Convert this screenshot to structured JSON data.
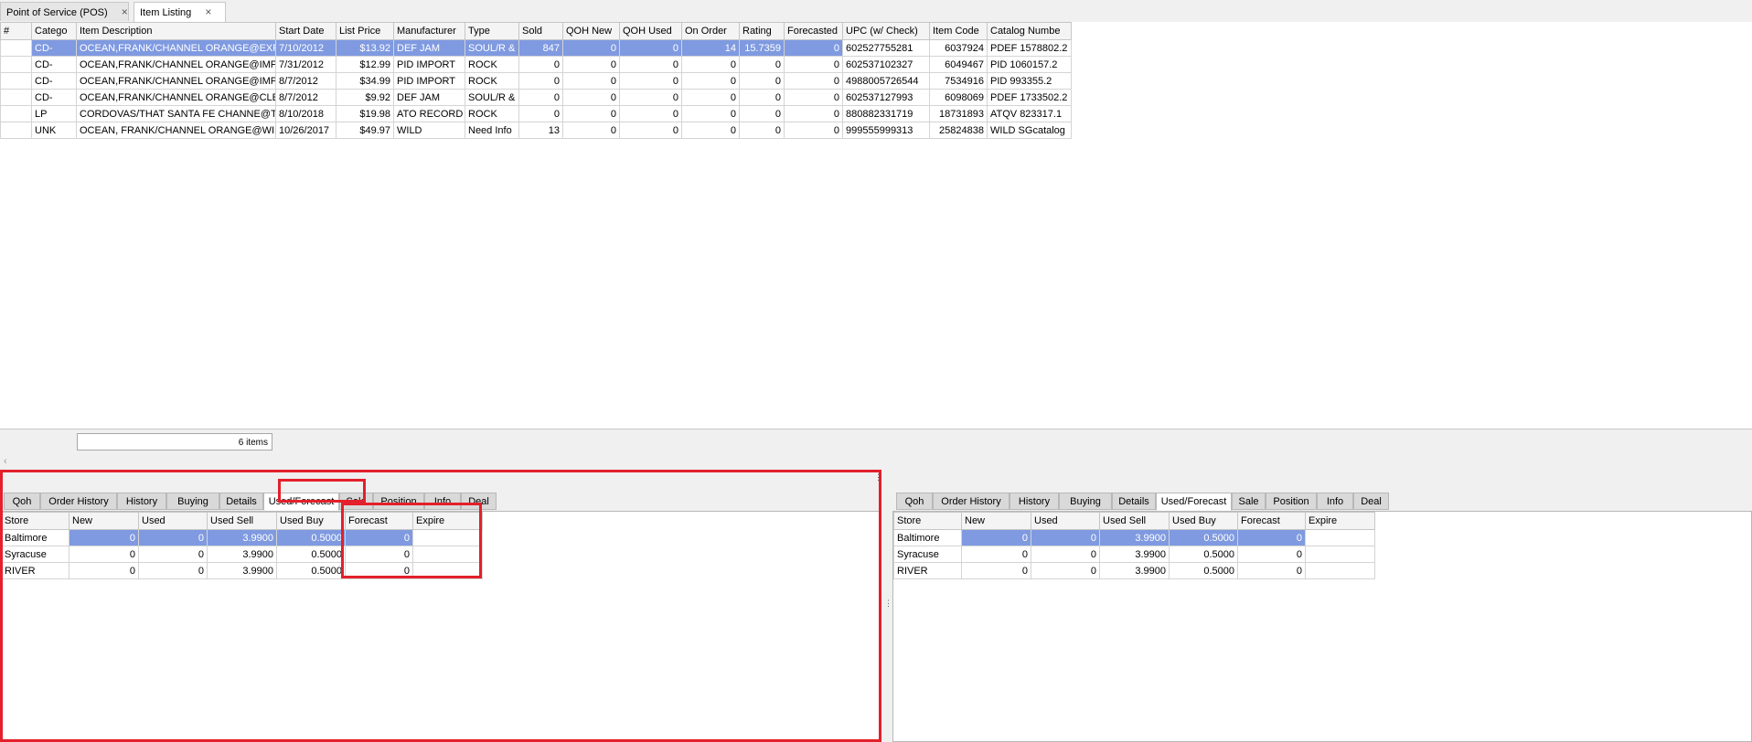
{
  "doc_tabs": [
    {
      "label": "Point of Service (POS)",
      "close": "×"
    },
    {
      "label": "Item Listing",
      "close": "×"
    }
  ],
  "listing": {
    "columns": [
      "#",
      "Catego",
      "Item Description",
      "Start Date",
      "List Price",
      "Manufacturer",
      "Type",
      "Sold",
      "QOH New",
      "QOH Used",
      "On Order",
      "Rating",
      "Forecasted",
      "UPC (w/ Check)",
      "Item Code",
      "Catalog Numbe"
    ],
    "rows": [
      [
        "",
        "CD-",
        "OCEAN,FRANK/CHANNEL ORANGE@EXPL",
        "7/10/2012",
        "$13.92",
        "DEF JAM",
        "SOUL/R &",
        "847",
        "0",
        "0",
        "14",
        "15.7359",
        "0",
        "602527755281",
        "6037924",
        "PDEF 1578802.2"
      ],
      [
        "",
        "CD-",
        "OCEAN,FRANK/CHANNEL ORANGE@IMP",
        "7/31/2012",
        "$12.99",
        "PID IMPORT",
        "ROCK",
        "0",
        "0",
        "0",
        "0",
        "0",
        "0",
        "602537102327",
        "6049467",
        "PID 1060157.2"
      ],
      [
        "",
        "CD-",
        "OCEAN,FRANK/CHANNEL ORANGE@IMP",
        "8/7/2012",
        "$34.99",
        "PID IMPORT",
        "ROCK",
        "0",
        "0",
        "0",
        "0",
        "0",
        "0",
        "4988005726544",
        "7534916",
        "PID 993355.2"
      ],
      [
        "",
        "CD-",
        "OCEAN,FRANK/CHANNEL ORANGE@CLEA",
        "8/7/2012",
        "$9.92",
        "DEF JAM",
        "SOUL/R &",
        "0",
        "0",
        "0",
        "0",
        "0",
        "0",
        "602537127993",
        "6098069",
        "PDEF 1733502.2"
      ],
      [
        "",
        "LP",
        "CORDOVAS/THAT SANTA FE CHANNE@T",
        "8/10/2018",
        "$19.98",
        "ATO RECORD",
        "ROCK",
        "0",
        "0",
        "0",
        "0",
        "0",
        "0",
        "880882331719",
        "18731893",
        "ATQV 823317.1"
      ],
      [
        "",
        "UNK",
        "OCEAN, FRANK/CHANNEL ORANGE@WIL",
        "10/26/2017",
        "$49.97",
        "WILD",
        "Need Info",
        "13",
        "0",
        "0",
        "0",
        "0",
        "0",
        "999555999313",
        "25824838",
        "WILD SGcatalog"
      ]
    ],
    "count_text": "6 items"
  },
  "left_panel": {
    "tabs": [
      "Qoh",
      "Order History",
      "History",
      "Buying",
      "Details",
      "Used/Forecast",
      "Sale",
      "Position",
      "Info",
      "Deal"
    ],
    "active_tab": "Used/Forecast",
    "columns": [
      "Store",
      "New",
      "Used",
      "Used Sell",
      "Used Buy",
      "Forecast",
      "Expire"
    ],
    "rows": [
      [
        "Baltimore",
        "0",
        "0",
        "3.9900",
        "0.5000",
        "0",
        ""
      ],
      [
        "Syracuse",
        "0",
        "0",
        "3.9900",
        "0.5000",
        "0",
        ""
      ],
      [
        "RIVER",
        "0",
        "0",
        "3.9900",
        "0.5000",
        "0",
        ""
      ]
    ]
  },
  "right_panel": {
    "tabs": [
      "Qoh",
      "Order History",
      "History",
      "Buying",
      "Details",
      "Used/Forecast",
      "Sale",
      "Position",
      "Info",
      "Deal"
    ],
    "active_tab": "Used/Forecast",
    "columns": [
      "Store",
      "New",
      "Used",
      "Used Sell",
      "Used Buy",
      "Forecast",
      "Expire"
    ],
    "rows": [
      [
        "Baltimore",
        "0",
        "0",
        "3.9900",
        "0.5000",
        "0",
        ""
      ],
      [
        "Syracuse",
        "0",
        "0",
        "3.9900",
        "0.5000",
        "0",
        ""
      ],
      [
        "RIVER",
        "0",
        "0",
        "3.9900",
        "0.5000",
        "0",
        ""
      ]
    ]
  },
  "colors": {
    "selection": "#7f9ae0",
    "highlight_box": "#e3202b",
    "tab_bar": "#f0f0f0"
  },
  "icons": {
    "tab_close": "close-icon",
    "scroll_left": "chevron-left-icon",
    "splitter": "grip-icon"
  }
}
